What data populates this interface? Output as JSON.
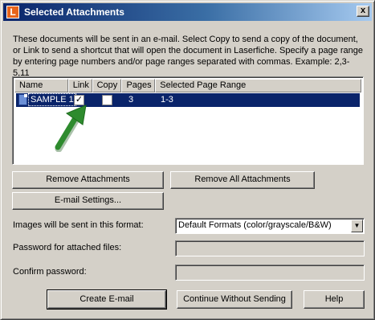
{
  "window": {
    "icon_letter": "L",
    "title": "Selected Attachments",
    "close_glyph": "x"
  },
  "description": "These documents will be sent in an e-mail. Select Copy to send a copy of the document, or Link to send a shortcut that will open the document in Laserfiche.  Specify a page range by entering page numbers and/or page ranges separated with commas.  Example: 2,3-5,11",
  "table": {
    "columns": [
      "Name",
      "Link",
      "Copy",
      "Pages",
      "Selected Page Range"
    ],
    "rows": [
      {
        "name": "SAMPLE 1",
        "link": true,
        "copy": false,
        "pages": "3",
        "page_range": "1-3",
        "selected": true
      }
    ],
    "check_glyph": "✓"
  },
  "buttons": {
    "remove_attachments": "Remove Attachments",
    "remove_all_attachments": "Remove All Attachments",
    "email_settings": "E-mail Settings...",
    "create_email": "Create E-mail",
    "continue_without_sending": "Continue Without Sending",
    "help": "Help"
  },
  "form": {
    "format_label": "Images will be sent in this format:",
    "format_value": "Default Formats (color/grayscale/B&W)",
    "password_label": "Password for attached files:",
    "confirm_label": "Confirm password:",
    "dropdown_glyph": "▼"
  },
  "colors": {
    "selection": "#0a246a",
    "arrow": "#2e8b2e",
    "app_icon": "#e8641b"
  }
}
